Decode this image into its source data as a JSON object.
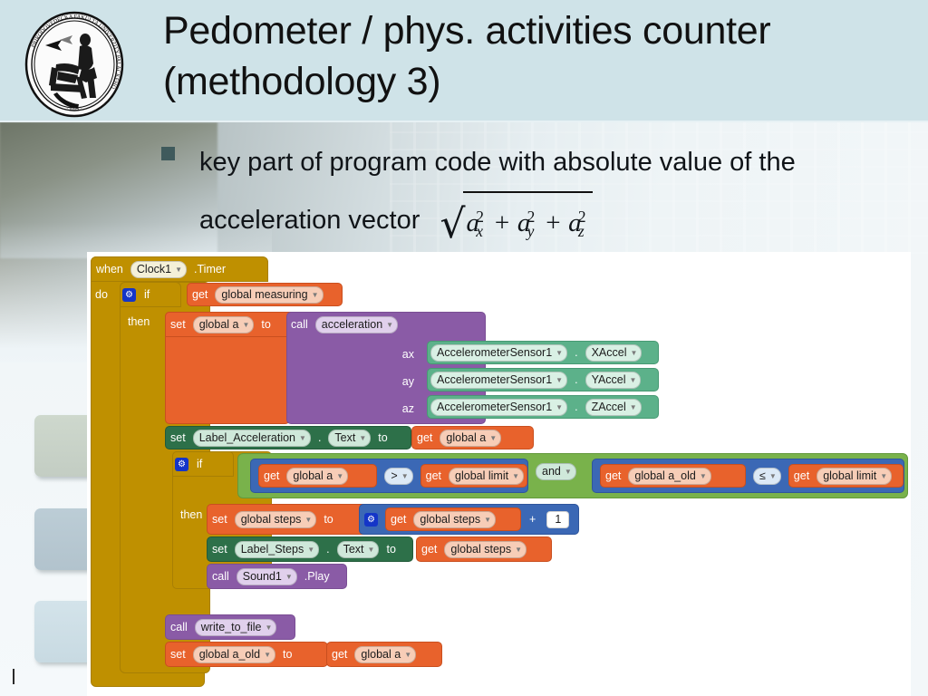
{
  "header": {
    "logo_name": "university-seal-logo",
    "title": "Pedometer / phys. activities counter (methodology 3)"
  },
  "bullet": {
    "marker": "square-bullet-icon",
    "text": "key part of program code with absolute value of the acceleration vector",
    "formula": {
      "root": "√",
      "terms": [
        {
          "base": "a",
          "sub": "x",
          "sup": "2"
        },
        {
          "base": "a",
          "sub": "y",
          "sup": "2"
        },
        {
          "base": "a",
          "sub": "z",
          "sup": "2"
        }
      ],
      "operator": "+",
      "plain": "sqrt(a_x^2 + a_y^2 + a_z^2)"
    }
  },
  "blocks": {
    "event": {
      "when": "when",
      "component": "Clock1",
      "event": ".Timer",
      "do": "do"
    },
    "outer_if": {
      "if": "if",
      "then": "then",
      "condition": {
        "get": "get",
        "variable": "global measuring"
      }
    },
    "set_accel": {
      "set": "set",
      "variable": "global a",
      "to": "to",
      "call": "call",
      "procedure": "acceleration",
      "args": [
        {
          "name": "ax",
          "component": "AccelerometerSensor1",
          "dot": ".",
          "property": "XAccel"
        },
        {
          "name": "ay",
          "component": "AccelerometerSensor1",
          "dot": ".",
          "property": "YAccel"
        },
        {
          "name": "az",
          "component": "AccelerometerSensor1",
          "dot": ".",
          "property": "ZAccel"
        }
      ]
    },
    "set_label_accel": {
      "set": "set",
      "component": "Label_Acceleration",
      "dot": ".",
      "property": "Text",
      "to": "to",
      "get": "get",
      "variable": "global a"
    },
    "inner_if": {
      "if": "if",
      "then": "then",
      "left_compare": {
        "get": "get",
        "left_var": "global a",
        "operator": ">",
        "right_get": "get",
        "right_var": "global limit"
      },
      "logic_operator": "and",
      "right_compare": {
        "get": "get",
        "left_var": "global a_old",
        "operator": "≤",
        "right_get": "get",
        "right_var": "global limit"
      }
    },
    "set_steps": {
      "set": "set",
      "variable": "global steps",
      "to": "to",
      "get": "get",
      "get_variable": "global steps",
      "operator": "+",
      "number": "1"
    },
    "set_label_steps": {
      "set": "set",
      "component": "Label_Steps",
      "dot": ".",
      "property": "Text",
      "to": "to",
      "get": "get",
      "variable": "global steps"
    },
    "call_sound": {
      "call": "call",
      "component": "Sound1",
      "method": ".Play"
    },
    "call_write": {
      "call": "call",
      "procedure": "write_to_file"
    },
    "set_a_old": {
      "set": "set",
      "variable": "global a_old",
      "to": "to",
      "get": "get",
      "get_variable": "global a"
    }
  },
  "colors": {
    "header_band": "#cfe3e8",
    "gold": "#bf9000",
    "orange": "#e8622c",
    "purple": "#8a5ba6",
    "green": "#2d7049",
    "light_green": "#79b24b",
    "sensor_green": "#5cb18a",
    "blue": "#3b68b5",
    "bullet": "#3f5a5c"
  }
}
